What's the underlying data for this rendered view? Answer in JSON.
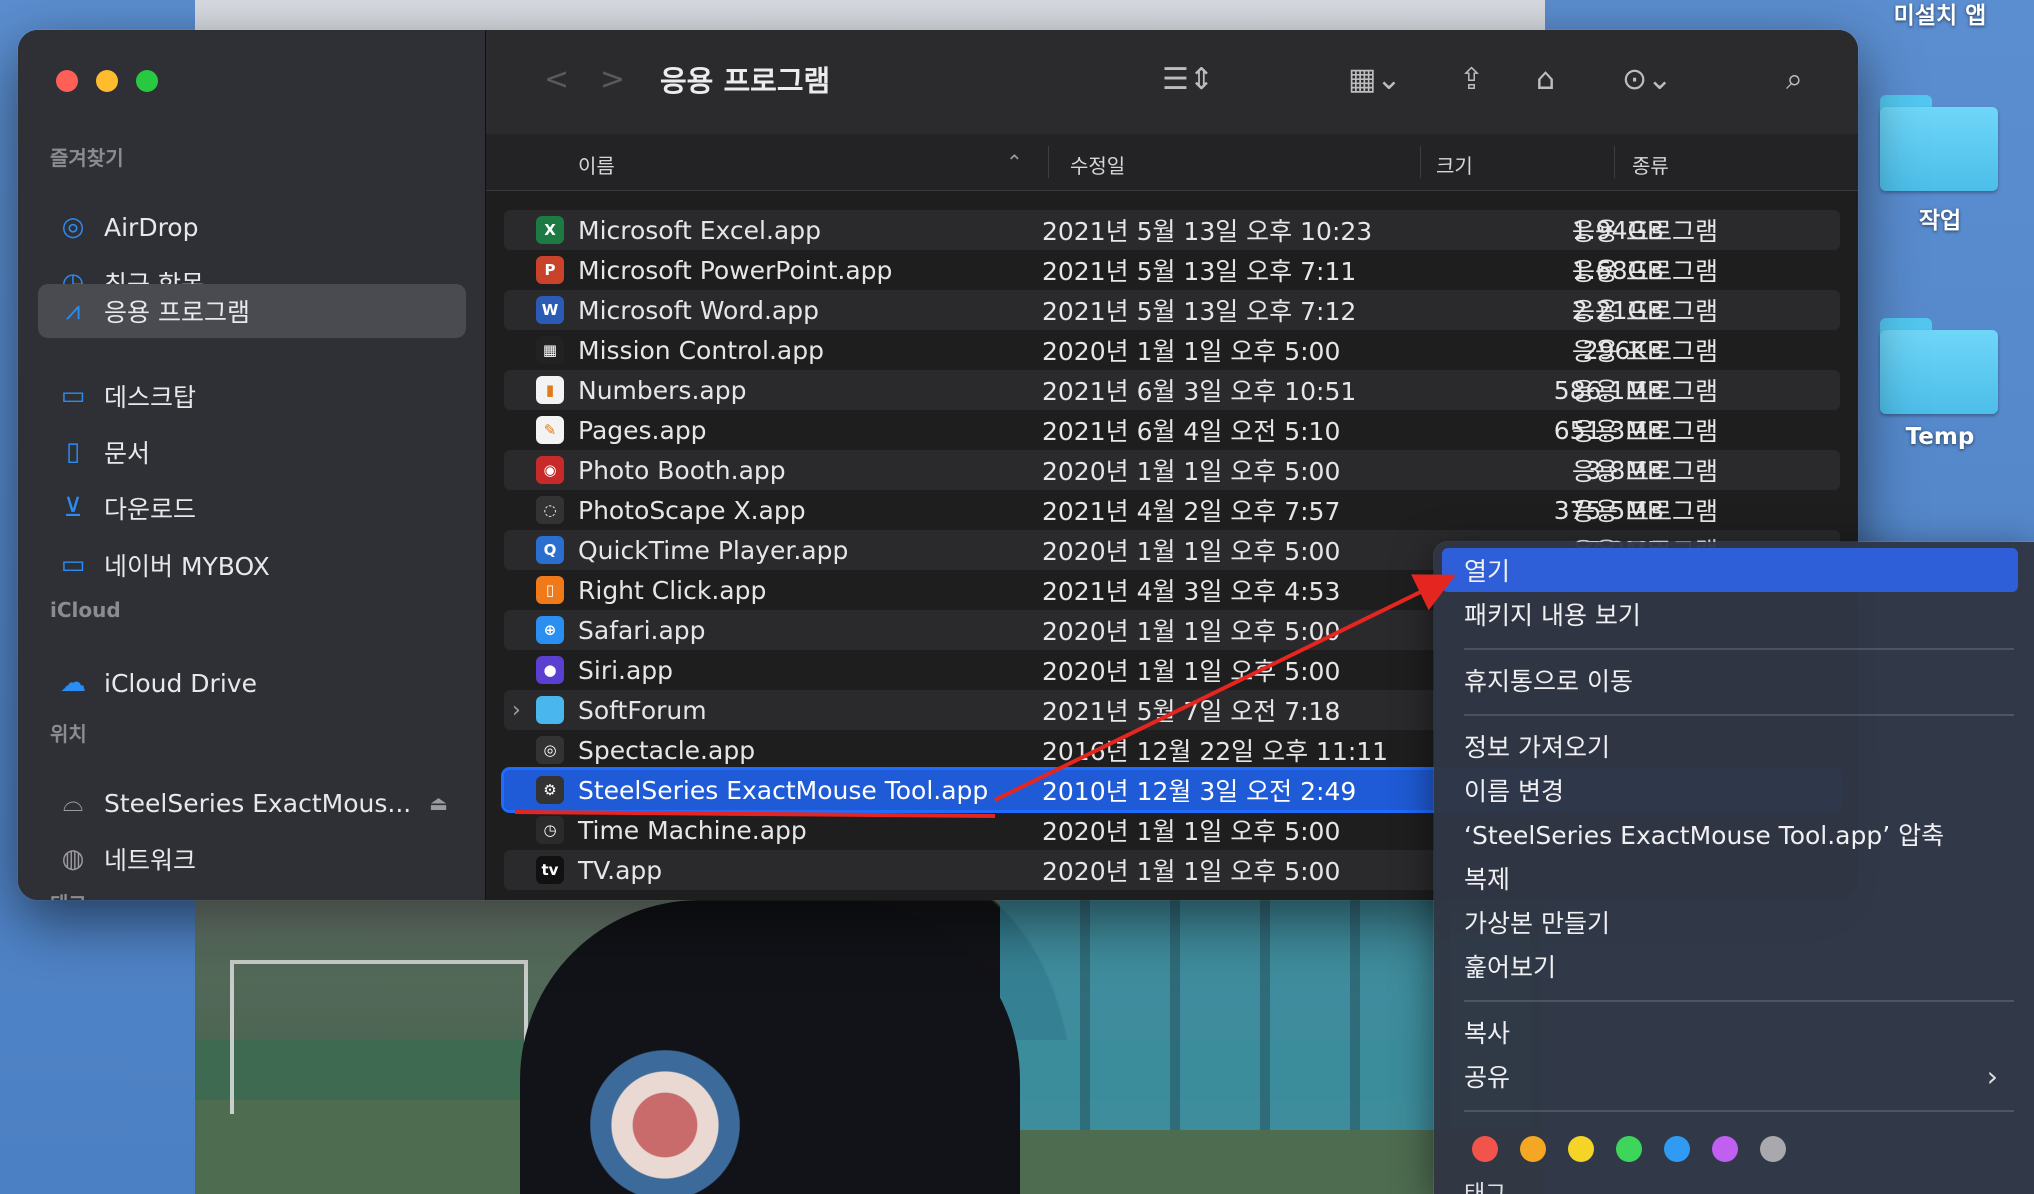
{
  "desktop": {
    "top_label": "미설치 앱",
    "folders": [
      {
        "name": "작업"
      },
      {
        "name": "Temp"
      }
    ]
  },
  "window": {
    "title": "응용 프로그램",
    "sidebar": {
      "sections": [
        {
          "label": "즐겨찾기"
        },
        {
          "label": "iCloud"
        },
        {
          "label": "위치"
        },
        {
          "label": "태그"
        }
      ],
      "favorites": [
        {
          "label": "AirDrop",
          "icon": "airdrop-icon"
        },
        {
          "label": "최근 항목",
          "icon": "clock-icon"
        },
        {
          "label": "응용 프로그램",
          "icon": "applications-icon",
          "active": true
        },
        {
          "label": "데스크탑",
          "icon": "desktop-icon"
        },
        {
          "label": "문서",
          "icon": "document-icon"
        },
        {
          "label": "다운로드",
          "icon": "download-icon"
        },
        {
          "label": "네이버 MYBOX",
          "icon": "folder-icon"
        }
      ],
      "icloud": [
        {
          "label": "iCloud Drive",
          "icon": "cloud-icon"
        }
      ],
      "locations": [
        {
          "label": "SteelSeries ExactMous...",
          "icon": "drive-icon"
        },
        {
          "label": "네트워크",
          "icon": "network-icon"
        }
      ]
    },
    "columns": {
      "name": "이름",
      "date": "수정일",
      "size": "크기",
      "kind": "종류"
    },
    "rows": [
      {
        "name": "Microsoft Excel.app",
        "date": "2021년 5월 13일 오후 10:23",
        "size": "1.94GB",
        "kind": "응용 프로그램",
        "icon_color": "#1d7a43",
        "icon_text": "X"
      },
      {
        "name": "Microsoft PowerPoint.app",
        "date": "2021년 5월 13일 오후 7:11",
        "size": "1.68GB",
        "kind": "응용 프로그램",
        "icon_color": "#c9432a",
        "icon_text": "P"
      },
      {
        "name": "Microsoft Word.app",
        "date": "2021년 5월 13일 오후 7:12",
        "size": "2.21GB",
        "kind": "응용 프로그램",
        "icon_color": "#2b5bb5",
        "icon_text": "W"
      },
      {
        "name": "Mission Control.app",
        "date": "2020년 1월 1일 오후 5:00",
        "size": "296KB",
        "kind": "응용 프로그램",
        "icon_color": "#222222",
        "icon_text": "▦"
      },
      {
        "name": "Numbers.app",
        "date": "2021년 6월 3일 오후 10:51",
        "size": "586.1MB",
        "kind": "응용 프로그램",
        "icon_color": "#f3f3f3",
        "icon_text": "▮"
      },
      {
        "name": "Pages.app",
        "date": "2021년 6월 4일 오전 5:10",
        "size": "651.3MB",
        "kind": "응용 프로그램",
        "icon_color": "#f3f3f3",
        "icon_text": "✎"
      },
      {
        "name": "Photo Booth.app",
        "date": "2020년 1월 1일 오후 5:00",
        "size": "3.8MB",
        "kind": "응용 프로그램",
        "icon_color": "#c82a2a",
        "icon_text": "◉"
      },
      {
        "name": "PhotoScape X.app",
        "date": "2021년 4월 2일 오후 7:57",
        "size": "375.5MB",
        "kind": "응용 프로그램",
        "icon_color": "#333333",
        "icon_text": "◌"
      },
      {
        "name": "QuickTime Player.app",
        "date": "2020년 1월 1일 오후 5:00",
        "size": "7.3MB",
        "kind": "응용 프로그램",
        "icon_color": "#2a6fd0",
        "icon_text": "Q"
      },
      {
        "name": "Right Click.app",
        "date": "2021년 4월 3일 오후 4:53",
        "size": "",
        "kind": "",
        "icon_color": "#f07a1a",
        "icon_text": "▯"
      },
      {
        "name": "Safari.app",
        "date": "2020년 1월 1일 오후 5:00",
        "size": "",
        "kind": "",
        "icon_color": "#2a8ff0",
        "icon_text": "⊕"
      },
      {
        "name": "Siri.app",
        "date": "2020년 1월 1일 오후 5:00",
        "size": "",
        "kind": "",
        "icon_color": "#5b3fd0",
        "icon_text": "●"
      },
      {
        "name": "SoftForum",
        "date": "2021년 5월 7일 오전 7:18",
        "size": "",
        "kind": "",
        "icon_color": "#49b7ee",
        "icon_text": "",
        "folder": true
      },
      {
        "name": "Spectacle.app",
        "date": "2016년 12월 22일 오후 11:11",
        "size": "",
        "kind": "",
        "icon_color": "#333333",
        "icon_text": "◎"
      },
      {
        "name": "SteelSeries ExactMouse Tool.app",
        "date": "2010년 12월 3일 오전 2:49",
        "size": "",
        "kind": "",
        "icon_color": "#333333",
        "icon_text": "⚙",
        "selected": true
      },
      {
        "name": "Time Machine.app",
        "date": "2020년 1월 1일 오후 5:00",
        "size": "",
        "kind": "",
        "icon_color": "#2b2b2b",
        "icon_text": "◷"
      },
      {
        "name": "TV.app",
        "date": "2020년 1월 1일 오후 5:00",
        "size": "",
        "kind": "",
        "icon_color": "#111111",
        "icon_text": "tv"
      }
    ]
  },
  "context_menu": {
    "items": [
      {
        "label": "열기",
        "highlighted": true
      },
      {
        "label": "패키지 내용 보기"
      },
      {
        "sep": true
      },
      {
        "label": "휴지통으로 이동"
      },
      {
        "sep": true
      },
      {
        "label": "정보 가져오기"
      },
      {
        "label": "이름 변경"
      },
      {
        "label": "‘SteelSeries ExactMouse Tool.app’ 압축"
      },
      {
        "label": "복제"
      },
      {
        "label": "가상본 만들기"
      },
      {
        "label": "훑어보기"
      },
      {
        "sep": true
      },
      {
        "label": "복사"
      },
      {
        "label": "공유",
        "submenu": true
      },
      {
        "sep": true
      }
    ],
    "tag_colors": [
      "#f2544b",
      "#f5a623",
      "#f5d327",
      "#3ed65a",
      "#2f9bf5",
      "#c05ff0",
      "#a8a8ad"
    ],
    "bottom_cut_label": "태그..."
  },
  "annotation_color": "#e5251f"
}
